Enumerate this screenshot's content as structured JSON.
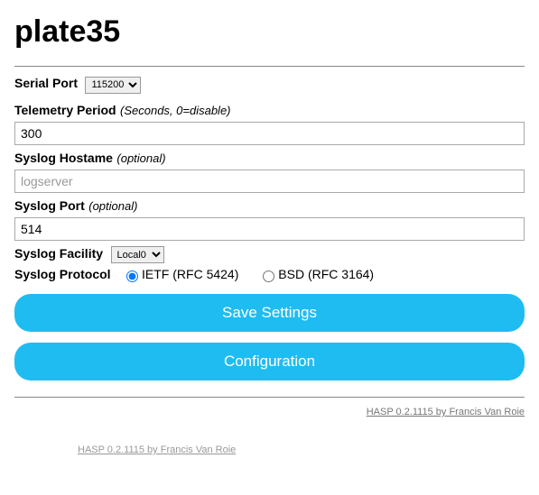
{
  "title": "plate35",
  "serial_port": {
    "label": "Serial Port",
    "value": "115200",
    "options": [
      "115200"
    ]
  },
  "telemetry": {
    "label": "Telemetry Period",
    "hint": "(Seconds, 0=disable)",
    "value": "300"
  },
  "syslog_host": {
    "label": "Syslog Hostame",
    "hint": "(optional)",
    "placeholder": "logserver",
    "value": ""
  },
  "syslog_port": {
    "label": "Syslog Port",
    "hint": "(optional)",
    "value": "514"
  },
  "syslog_facility": {
    "label": "Syslog Facility",
    "value": "Local0",
    "options": [
      "Local0"
    ]
  },
  "syslog_protocol": {
    "label": "Syslog Protocol",
    "option1": "IETF (RFC 5424)",
    "option2": "BSD (RFC 3164)",
    "selected": "ietf"
  },
  "buttons": {
    "save": "Save Settings",
    "config": "Configuration"
  },
  "footer": {
    "link1": "HASP 0.2.1115 by Francis Van Roie",
    "link2": "HASP 0.2.1115 by Francis Van Roie"
  }
}
